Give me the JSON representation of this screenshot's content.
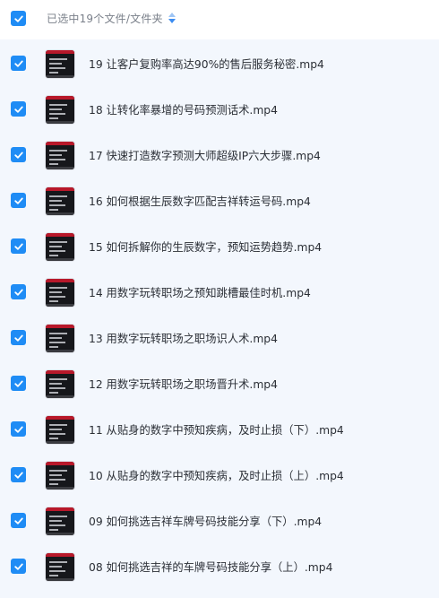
{
  "header": {
    "label": "已选中19个文件/文件夹"
  },
  "files": [
    {
      "name": "19 让客户复购率高达90%的售后服务秘密.mp4"
    },
    {
      "name": "18 让转化率暴增的号码预测话术.mp4"
    },
    {
      "name": "17 快速打造数字预测大师超级IP六大步骤.mp4"
    },
    {
      "name": "16 如何根据生辰数字匹配吉祥转运号码.mp4"
    },
    {
      "name": "15 如何拆解你的生辰数字，预知运势趋势.mp4"
    },
    {
      "name": "14 用数字玩转职场之预知跳槽最佳时机.mp4"
    },
    {
      "name": "13 用数字玩转职场之职场识人术.mp4"
    },
    {
      "name": "12 用数字玩转职场之职场晋升术.mp4"
    },
    {
      "name": "11 从贴身的数字中预知疾病，及时止损（下）.mp4"
    },
    {
      "name": "10 从贴身的数字中预知疾病，及时止损（上）.mp4"
    },
    {
      "name": "09 如何挑选吉祥车牌号码技能分享（下）.mp4"
    },
    {
      "name": "08 如何挑选吉祥的车牌号码技能分享（上）.mp4"
    }
  ],
  "colors": {
    "accent": "#1f8cf5",
    "list_background": "#f3f7fd"
  }
}
